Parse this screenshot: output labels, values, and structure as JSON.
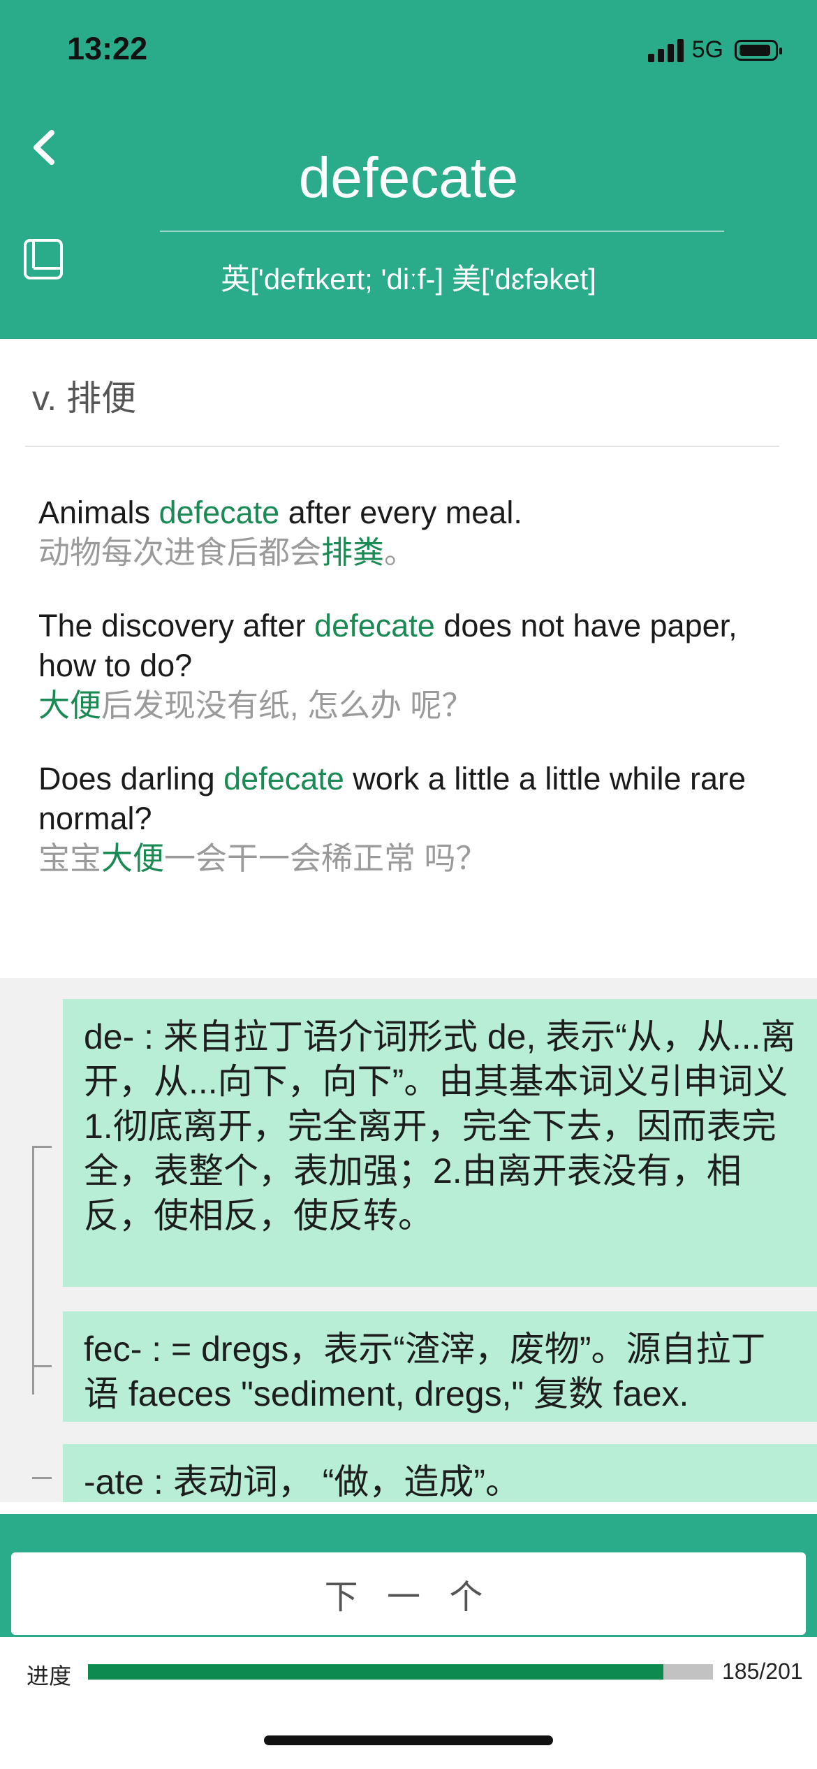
{
  "status_bar": {
    "time": "13:22",
    "network": "5G",
    "battery_level": 0.85
  },
  "header": {
    "word": "defecate",
    "phonetic": "英['defɪkeɪt; 'diːf-]  美['dɛfəket]",
    "back_icon": "chevron-left-icon",
    "wordbook_icon": "book-icon"
  },
  "definition": {
    "text": "v. 排便"
  },
  "examples": [
    {
      "en": {
        "before": "Animals ",
        "highlight": "defecate",
        "after": " after every meal."
      },
      "cn": {
        "before": "动物每次进食后都会",
        "highlight": "排粪",
        "after": "。"
      }
    },
    {
      "en": {
        "before": "The discovery after ",
        "highlight": "defecate",
        "after": " does not have paper, how to do?"
      },
      "cn": {
        "before": "",
        "highlight": "大便",
        "after": "后发现没有纸, 怎么办 呢？"
      }
    },
    {
      "en": {
        "before": "Does darling ",
        "highlight": "defecate",
        "after": " work a little a little while rare normal?"
      },
      "cn": {
        "before": "宝宝",
        "highlight": "大便",
        "after": "一会干一会稀正常 吗？"
      }
    }
  ],
  "etymology": [
    {
      "text": "de- : 来自拉丁语介词形式 de, 表示“从，从...离开，从...向下，向下”。由其基本词义引申词义 1.彻底离开，完全离开，完全下去，因而表完全，表整个，表加强；2.由离开表没有，相反，使相反，使反转。"
    },
    {
      "text": "fec- : = dregs，表示“渣滓，废物”。源自拉丁语 faeces \"sediment, dregs,\" 复数 faex."
    },
    {
      "text": "-ate : 表动词， “做，造成”。"
    }
  ],
  "footer": {
    "next_label": "下 一 个"
  },
  "progress": {
    "label": "进度",
    "current": 185,
    "total": 201,
    "count_text": "185/201"
  },
  "colors": {
    "primary": "#2aab8a",
    "highlight": "#1a8a55",
    "etymology_box": "#b8eed6",
    "progress_fill": "#0d8a4f"
  }
}
